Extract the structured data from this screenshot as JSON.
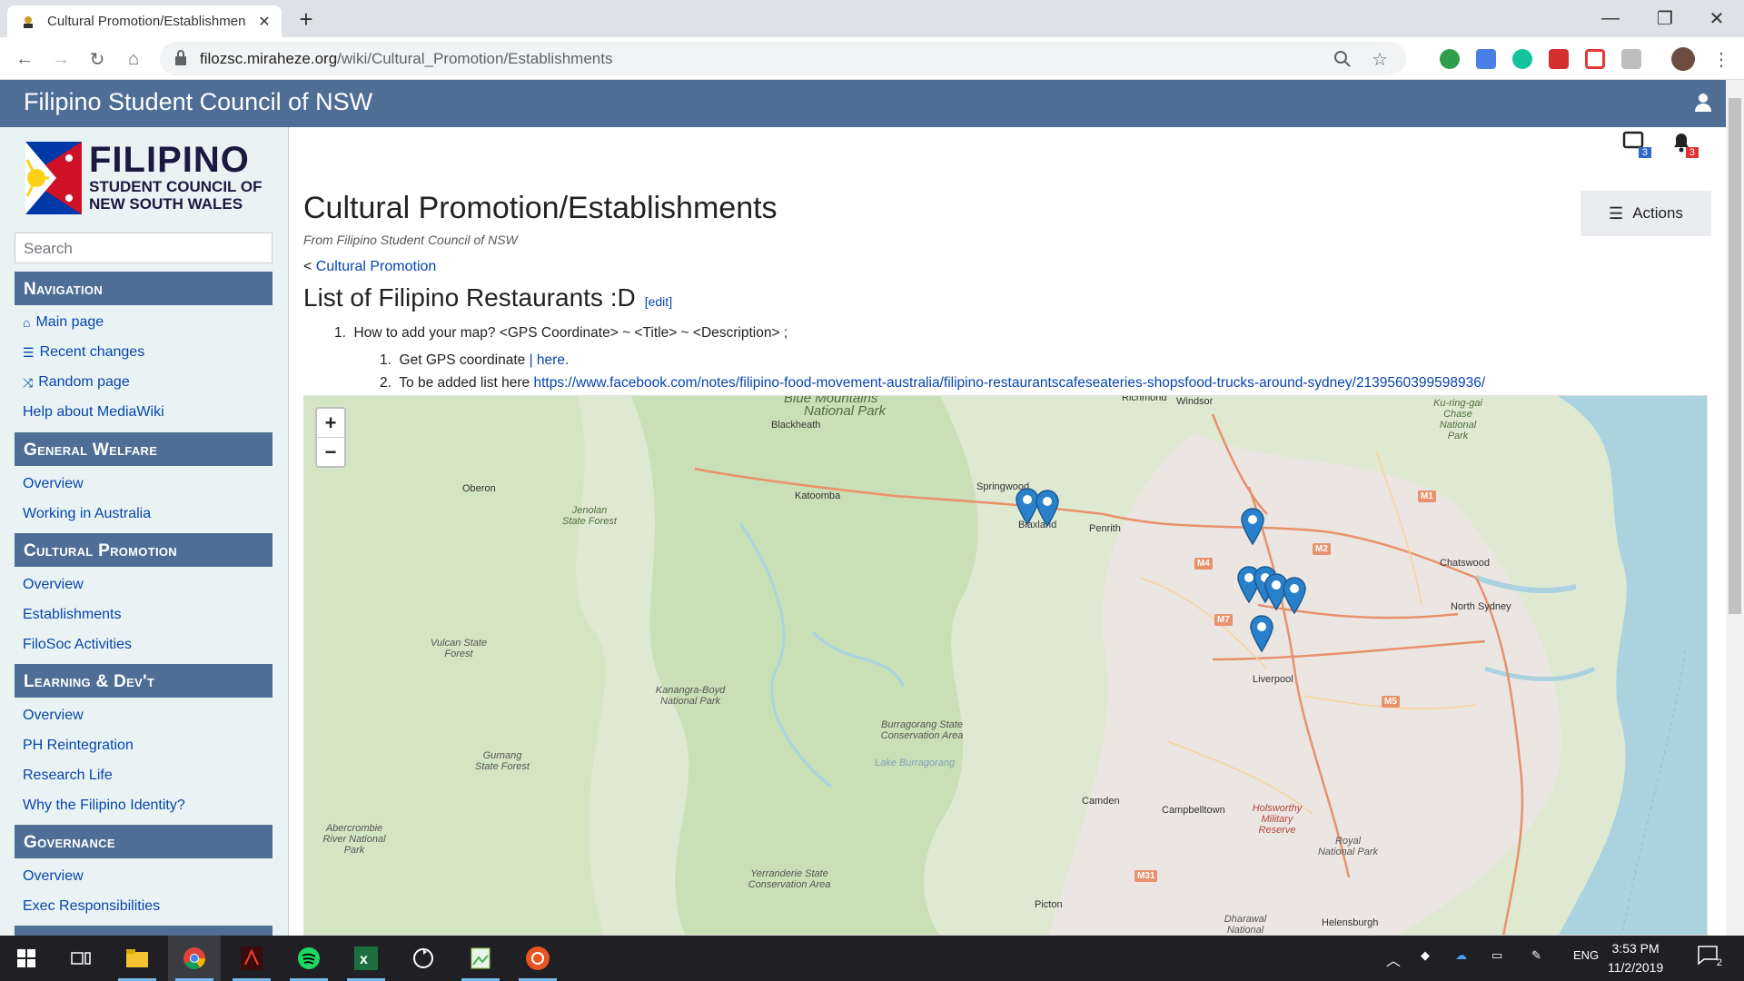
{
  "browser": {
    "tab_title": "Cultural Promotion/Establishmen",
    "url_host": "filozsc.miraheze.org",
    "url_path": "/wiki/Cultural_Promotion/Establishments"
  },
  "wiki": {
    "site_name": "Filipino Student Council of NSW",
    "logo_line1": "FILIPINO",
    "logo_line2": "STUDENT COUNCIL OF",
    "logo_line3": "NEW SOUTH WALES",
    "search_placeholder": "Search",
    "notification_counts": {
      "messages": "3",
      "alerts": "3"
    }
  },
  "sidebar": {
    "navigation": {
      "title": "Navigation",
      "items": [
        {
          "label": "Main page",
          "icon": "home-icon"
        },
        {
          "label": "Recent changes",
          "icon": "list-icon"
        },
        {
          "label": "Random page",
          "icon": "shuffle-icon"
        },
        {
          "label": "Help about MediaWiki",
          "icon": ""
        }
      ]
    },
    "general_welfare": {
      "title": "General Welfare",
      "items": [
        "Overview",
        "Working in Australia"
      ]
    },
    "cultural_promotion": {
      "title": "Cultural Promotion",
      "items": [
        "Overview",
        "Establishments",
        "FiloSoc Activities"
      ]
    },
    "learning": {
      "title": "Learning & Dev't",
      "items": [
        "Overview",
        "PH Reintegration",
        "Research Life",
        "Why the Filipino Identity?"
      ]
    },
    "governance": {
      "title": "Governance",
      "items": [
        "Overview",
        "Exec Responsibilities"
      ]
    }
  },
  "page": {
    "title": "Cultural Promotion/Establishments",
    "subtitle": "From Filipino Student Council of NSW",
    "breadcrumb_prefix": "<",
    "breadcrumb_link": "Cultural Promotion",
    "actions_label": "Actions",
    "section_heading": "List of Filipino Restaurants :D",
    "edit_label": "edit",
    "list_item_1": "How to add your map? <GPS Coordinate> ~ <Title> ~ <Description> ;",
    "sub_item_1_text": "Get GPS coordinate",
    "sub_item_1_link": "here.",
    "sub_item_2_text": "To be added list here",
    "sub_item_2_link": "https://www.facebook.com/notes/filipino-food-movement-australia/filipino-restaurantscafeseateries-shopsfood-trucks-around-sydney/2139560399598936/"
  },
  "map": {
    "zoom_in": "+",
    "zoom_out": "−",
    "labels": {
      "blue_mountains": "Blue Mountains",
      "national_park": "National Park",
      "richmond": "Richmond",
      "windsor": "Windsor",
      "kuring_gai": "Ku-ring-gai Chase National Park",
      "blackheath": "Blackheath",
      "oberon": "Oberon",
      "katoomba": "Katoomba",
      "springwood": "Springwood",
      "blaxland": "Blaxland",
      "penrith": "Penrith",
      "jenolan": "Jenolan State Forest",
      "chatswood": "Chatswood",
      "north_sydney": "North Sydney",
      "vulcan": "Vulcan State Forest",
      "kanangra": "Kanangra-Boyd National Park",
      "liverpool": "Liverpool",
      "burragorang": "Burragorang State Conservation Area",
      "lake_burragorang": "Lake Burragorang",
      "gurnang": "Gurnang State Forest",
      "camden": "Camden",
      "campbelltown": "Campbelltown",
      "holsworthy": "Holsworthy Military Reserve",
      "royal_np": "Royal National Park",
      "abercrombie": "Abercrombie River National Park",
      "yerranderie": "Yerranderie State Conservation Area",
      "picton": "Picton",
      "dharawal": "Dharawal National",
      "helensburgh": "Helensburgh"
    },
    "roads": [
      "M1",
      "M2",
      "M4",
      "M7",
      "M5",
      "M31"
    ],
    "marker_count": 8
  },
  "taskbar": {
    "language": "ENG",
    "time": "3:53 PM",
    "date": "11/2/2019",
    "notif_count": "2"
  }
}
